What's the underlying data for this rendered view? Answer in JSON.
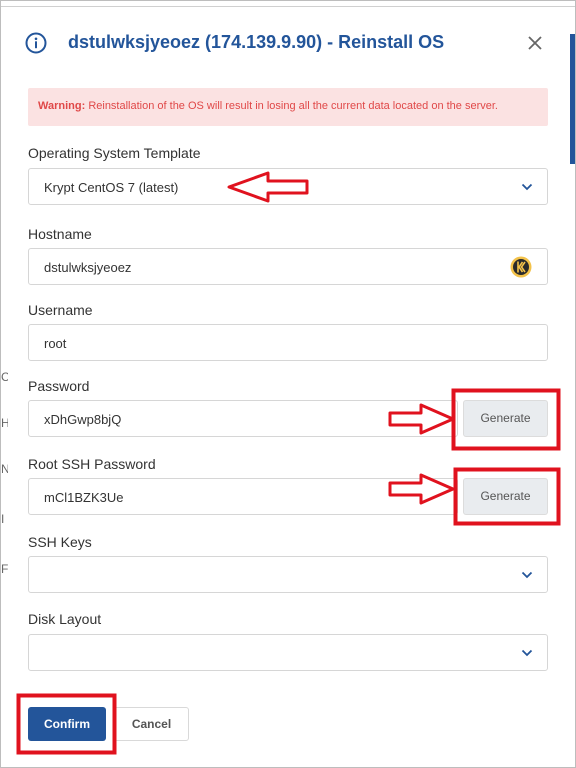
{
  "modal": {
    "title": "dstulwksjyeoez (174.139.9.90) - Reinstall OS",
    "warning_prefix": "Warning:",
    "warning_text": "Reinstallation of the OS will result in losing all the current data located on the server."
  },
  "form": {
    "os_template": {
      "label": "Operating System Template",
      "value": "Krypt CentOS 7 (latest)"
    },
    "hostname": {
      "label": "Hostname",
      "value": "dstulwksjyeoez"
    },
    "username": {
      "label": "Username",
      "value": "root"
    },
    "password": {
      "label": "Password",
      "value": "xDhGwp8bjQ",
      "generate_label": "Generate"
    },
    "root_ssh_password": {
      "label": "Root SSH Password",
      "value": "mCl1BZK3Ue",
      "generate_label": "Generate"
    },
    "ssh_keys": {
      "label": "SSH Keys",
      "value": ""
    },
    "disk_layout": {
      "label": "Disk Layout",
      "value": ""
    }
  },
  "actions": {
    "confirm_label": "Confirm",
    "cancel_label": "Cancel"
  },
  "colors": {
    "accent": "#23559a",
    "warning_bg": "#fbe2e2",
    "warning_text": "#e04848",
    "annotation": "#e0121e"
  },
  "background_letters": [
    "C",
    "H",
    "N",
    "I",
    "F"
  ]
}
